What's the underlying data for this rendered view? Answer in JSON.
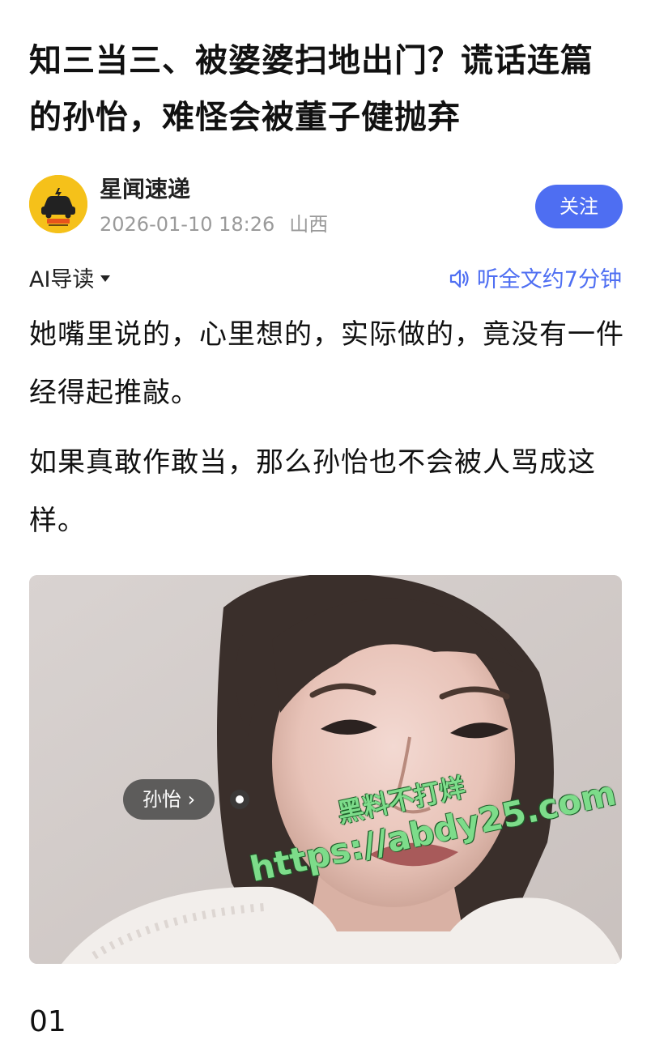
{
  "article": {
    "title": "知三当三、被婆婆扫地出门？谎话连篇的孙怡，难怪会被董子健抛弃",
    "author": {
      "name": "星闻速递",
      "date": "2026-01-10 18:26",
      "location": "山西",
      "avatar_icon": "car-logo-icon",
      "follow_label": "关注"
    },
    "ai_guide_label": "AI导读",
    "listen_label": "听全文约7分钟",
    "paragraphs": [
      "她嘴里说的，心里想的，实际做的，竟没有一件经得起推敲。",
      "如果真敢作敢当，那么孙怡也不会被人骂成这样。"
    ],
    "image": {
      "person_tag": "孙怡 ›",
      "watermark_line1": "黑料不打烊",
      "watermark_line2": "https://abdy25.com"
    },
    "section_number": "01"
  },
  "colors": {
    "accent": "#4e6ef2",
    "meta_gray": "#9a9a9a",
    "avatar_yellow": "#f5c11a",
    "watermark_green": "#7ddc8a"
  }
}
